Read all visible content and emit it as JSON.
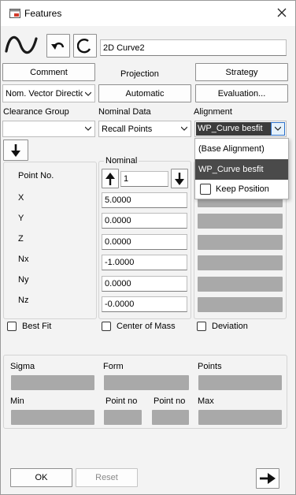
{
  "window": {
    "title": "Features",
    "close_glyph": "✕"
  },
  "feature_name": "2D Curve2",
  "toolbar": {
    "comment": "Comment",
    "projection_label": "Projection",
    "strategy": "Strategy",
    "nom_vector": "Nom. Vector Direction",
    "projection_value": "Automatic",
    "evaluation": "Evaluation..."
  },
  "sections": {
    "clearance_group": "Clearance Group",
    "nominal_data": "Nominal Data",
    "alignment": "Alignment"
  },
  "nominal_data_value": "Recall Points",
  "alignment_value": "WP_Curve besfit",
  "alignment_dropdown": {
    "options": [
      "(Base Alignment)",
      "WP_Curve besfit"
    ],
    "selected_index": 1,
    "keep_position": "Keep Position"
  },
  "point_panel": {
    "labels": [
      "Point No.",
      "X",
      "Y",
      "Z",
      "Nx",
      "Ny",
      "Nz"
    ]
  },
  "nominal": {
    "title": "Nominal",
    "point_no": "1",
    "values": [
      "5.0000",
      "0.0000",
      "0.0000",
      "-1.0000",
      "0.0000",
      "-0.0000"
    ]
  },
  "checkboxes": {
    "best_fit": "Best Fit",
    "center_of_mass": "Center of Mass",
    "deviation": "Deviation"
  },
  "stats": {
    "sigma": "Sigma",
    "form": "Form",
    "points": "Points",
    "min": "Min",
    "point_no_1": "Point no",
    "point_no_2": "Point no",
    "max": "Max"
  },
  "footer": {
    "ok": "OK",
    "reset": "Reset"
  },
  "colors": {
    "selected_bg": "#4a4a4a",
    "gray_field": "#a9a9a9"
  }
}
